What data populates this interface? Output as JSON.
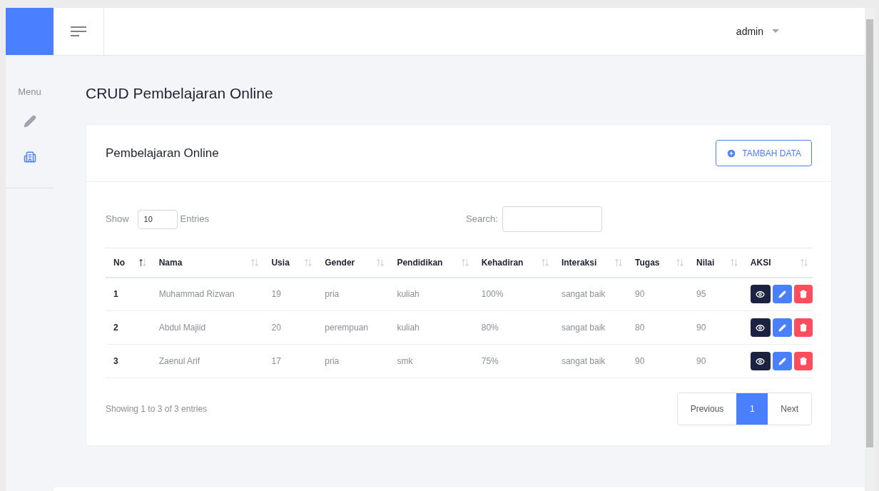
{
  "header": {
    "user": "admin"
  },
  "sidebar": {
    "title": "Menu",
    "items": [
      {
        "kind": "pencil",
        "selected": false
      },
      {
        "kind": "building",
        "selected": true
      }
    ]
  },
  "page_title": "CRUD Pembelajaran Online",
  "card": {
    "title": "Pembelajaran Online",
    "add_button": "TAMBAH DATA"
  },
  "controls": {
    "show_label": "Show",
    "page_length": "10",
    "entries_label": "Entries",
    "search_label": "Search:"
  },
  "table": {
    "columns": [
      {
        "label": "No",
        "sorted": true
      },
      {
        "label": "Nama",
        "sorted": false
      },
      {
        "label": "Usia",
        "sorted": false
      },
      {
        "label": "Gender",
        "sorted": false
      },
      {
        "label": "Pendidikan",
        "sorted": false
      },
      {
        "label": "Kehadiran",
        "sorted": false
      },
      {
        "label": "Interaksi",
        "sorted": false
      },
      {
        "label": "Tugas",
        "sorted": false
      },
      {
        "label": "Nilai",
        "sorted": false
      },
      {
        "label": "AKSI",
        "sorted": false
      }
    ],
    "rows": [
      {
        "cells": [
          "1",
          "Muhammad Rizwan",
          "19",
          "pria",
          "kuliah",
          "100%",
          "sangat baik",
          "90",
          "95"
        ]
      },
      {
        "cells": [
          "2",
          "Abdul Majiid",
          "20",
          "perempuan",
          "kuliah",
          "80%",
          "sangat baik",
          "80",
          "90"
        ]
      },
      {
        "cells": [
          "3",
          "Zaenul Arif",
          "17",
          "pria",
          "smk",
          "75%",
          "sangat baik",
          "90",
          "90"
        ]
      }
    ]
  },
  "info": "Showing 1 to 3 of 3 entries",
  "pagination": {
    "previous": "Previous",
    "pages": [
      {
        "label": "1",
        "selected": true
      }
    ],
    "next": "Next"
  }
}
